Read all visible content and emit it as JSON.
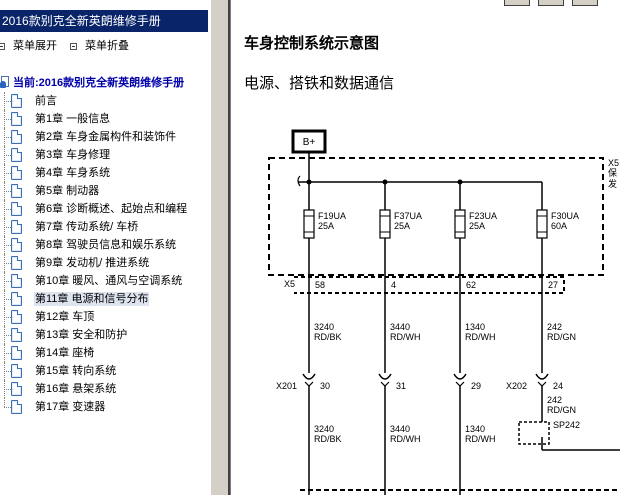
{
  "left_panel": {
    "title": "2016款别克全新英朗维修手册",
    "menu": {
      "expand_label": "菜单展开",
      "collapse_label": "菜单折叠"
    },
    "tree_root_label": "当前:2016款别克全新英朗维修手册",
    "tree_items": [
      {
        "label": "前言"
      },
      {
        "label": "第1章 一般信息"
      },
      {
        "label": "第2章 车身金属构件和装饰件"
      },
      {
        "label": "第3章 车身修理"
      },
      {
        "label": "第4章 车身系统"
      },
      {
        "label": "第5章 制动器"
      },
      {
        "label": "第6章 诊断概述、起始点和编程"
      },
      {
        "label": "第7章 传动系统/ 车桥"
      },
      {
        "label": "第8章 驾驶员信息和娱乐系统"
      },
      {
        "label": "第9章 发动机/ 推进系统"
      },
      {
        "label": "第10章 暖风、通风与空调系统"
      },
      {
        "label": "第11章 电源和信号分布",
        "selected": true
      },
      {
        "label": "第12章 车顶"
      },
      {
        "label": "第13章 安全和防护"
      },
      {
        "label": "第14章 座椅"
      },
      {
        "label": "第15章 转向系统"
      },
      {
        "label": "第16章 悬架系统"
      },
      {
        "label": "第17章 变速器"
      }
    ]
  },
  "document": {
    "title": "车身控制系统示意图",
    "subtitle": "电源、搭铁和数据通信",
    "diagram": {
      "power_label": "B+",
      "box_side_label": [
        "X5",
        "保",
        "发"
      ],
      "fuses": [
        {
          "name": "F19UA",
          "rating": "25A",
          "pin": "58",
          "wire_top": [
            "3240",
            "RD/BK"
          ],
          "connector_pin": "30",
          "wire_bottom": [
            "3240",
            "RD/BK"
          ]
        },
        {
          "name": "F37UA",
          "rating": "25A",
          "pin": "4",
          "wire_top": [
            "3440",
            "RD/WH"
          ],
          "connector_pin": "31",
          "wire_bottom": [
            "3440",
            "RD/WH"
          ]
        },
        {
          "name": "F23UA",
          "rating": "25A",
          "pin": "62",
          "wire_top": [
            "1340",
            "RD/WH"
          ],
          "connector_pin": "29",
          "wire_bottom": [
            "1340",
            "RD/WH"
          ]
        },
        {
          "name": "F30UA",
          "rating": "60A",
          "pin": "27",
          "wire_top": [
            "242",
            "RD/GN"
          ],
          "connector_pin": "24",
          "wire_bottom": [
            "242",
            "RD/GN"
          ]
        }
      ],
      "connector_x5": "X5",
      "connector_x201": "X201",
      "connector_x202": "X202",
      "splice": "SP242"
    }
  },
  "colors": {
    "title_bar": "#0a246a",
    "splitter": "#d4d0c8",
    "selected_bg": "#dde4ef",
    "root_text": "#0000aa"
  }
}
